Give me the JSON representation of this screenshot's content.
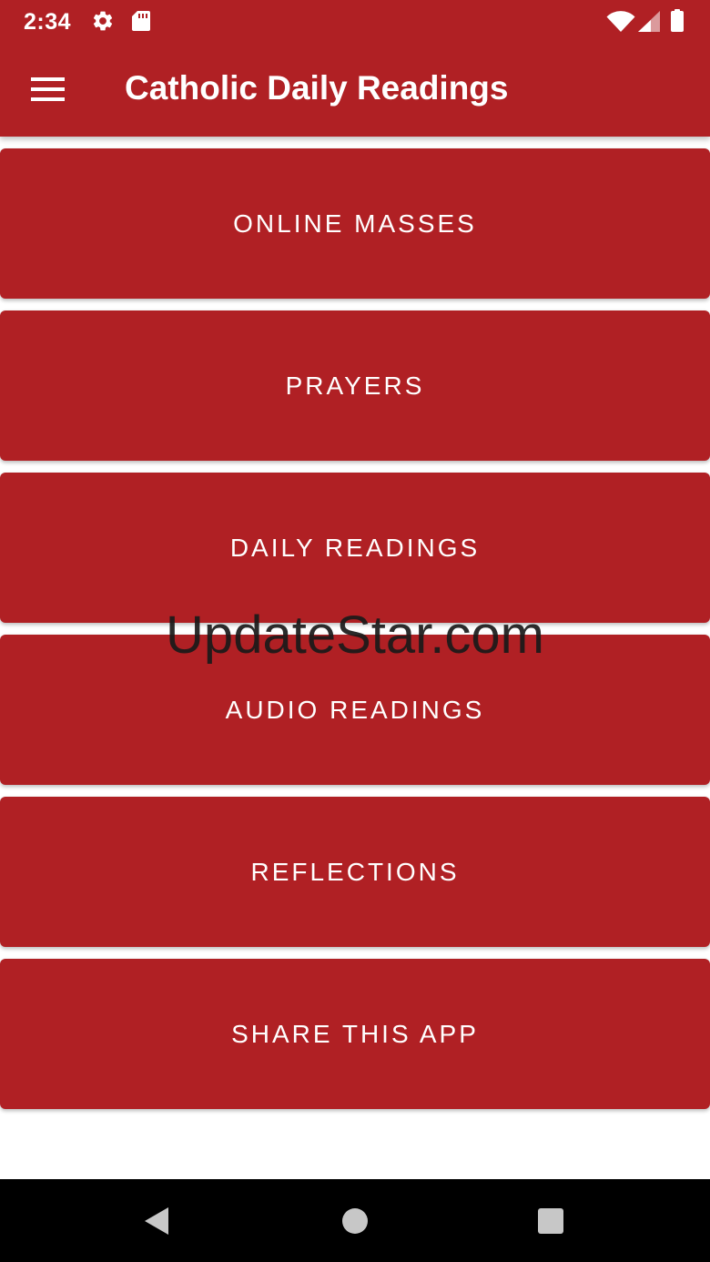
{
  "status_bar": {
    "time": "2:34",
    "left_icons": [
      "gear-icon",
      "sd-card-icon"
    ],
    "right_icons": [
      "wifi-icon",
      "cell-signal-icon",
      "battery-icon"
    ]
  },
  "toolbar": {
    "menu_icon": "hamburger-menu-icon",
    "title": "Catholic Daily Readings"
  },
  "menu": {
    "items": [
      {
        "label": "ONLINE MASSES"
      },
      {
        "label": "PRAYERS"
      },
      {
        "label": "DAILY READINGS"
      },
      {
        "label": "AUDIO READINGS"
      },
      {
        "label": "REFLECTIONS"
      },
      {
        "label": "SHARE THIS APP"
      }
    ]
  },
  "watermark": "UpdateStar.com",
  "nav_bar": {
    "buttons": [
      "back-icon",
      "home-icon",
      "recents-icon"
    ]
  },
  "colors": {
    "primary": "#b02024",
    "on_primary": "#ffffff",
    "background": "#ffffff",
    "nav_bar": "#000000"
  }
}
